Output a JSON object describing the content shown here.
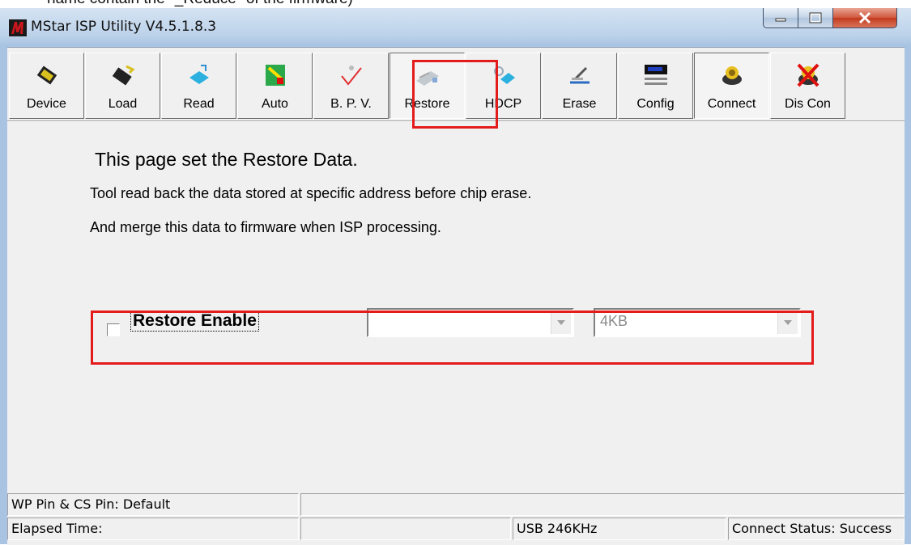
{
  "top_caption": "name contain the \"_Reduce\" of the firmware)",
  "window": {
    "title": "MStar ISP Utility V4.5.1.8.3"
  },
  "caption_buttons": {
    "minimize": "–",
    "maximize": "☐",
    "close": "x"
  },
  "toolbar": {
    "items": [
      {
        "label": "Device",
        "icon": "chip-icon"
      },
      {
        "label": "Load",
        "icon": "chip-load-icon"
      },
      {
        "label": "Read",
        "icon": "read-icon"
      },
      {
        "label": "Auto",
        "icon": "auto-icon"
      },
      {
        "label": "B. P. V.",
        "icon": "check-icon"
      },
      {
        "label": "Restore",
        "icon": "restore-icon",
        "pressed": true
      },
      {
        "label": "HDCP",
        "icon": "hdcp-icon"
      },
      {
        "label": "Erase",
        "icon": "erase-icon"
      },
      {
        "label": "Config",
        "icon": "config-icon"
      },
      {
        "label": "Connect",
        "icon": "connect-icon"
      },
      {
        "label": "Dis Con",
        "icon": "disconnect-icon"
      }
    ]
  },
  "page": {
    "heading": "This page set the Restore Data.",
    "desc1": "Tool read back the data stored at specific address before chip erase.",
    "desc2": "And merge this data to firmware when ISP processing.",
    "restore_enable_label": "Restore Enable",
    "restore_enable_checked": false,
    "address_value": "",
    "size_value": "4KB"
  },
  "status": {
    "wp_cs": "WP Pin & CS Pin: Default",
    "elapsed": "Elapsed Time:",
    "usb": "USB  246KHz",
    "connect_status": "Connect Status: Success"
  },
  "colors": {
    "highlight": "#e31b1b",
    "window_bg": "#f0f0f0",
    "frame": "#a9c4e2"
  }
}
